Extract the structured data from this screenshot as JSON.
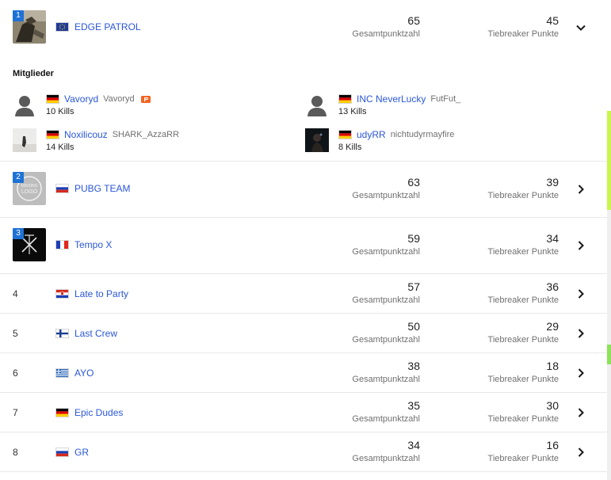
{
  "expanded_team": {
    "rank": "1",
    "name": "EDGE PATROL",
    "flag": "eu",
    "total": "65",
    "total_label": "Gesamtpunktzahl",
    "tiebreaker": "45",
    "tiebreaker_label": "Tiebreaker Punkte",
    "toggle_icon": "chevron-down-icon",
    "members_title": "Mitglieder",
    "members": [
      {
        "name": "Vavoryd",
        "handle": "Vavoryd",
        "kills": "10 Kills",
        "flag": "de",
        "extra_icon": "platform-p-icon",
        "avatar": "silhouette-avatar"
      },
      {
        "name": "INC NeverLucky",
        "handle": "FutFut_",
        "kills": "13 Kills",
        "flag": "de",
        "avatar": "silhouette-avatar"
      },
      {
        "name": "Noxilicouz",
        "handle": "SHARK_AzzaRR",
        "kills": "14 Kills",
        "flag": "de",
        "avatar": "photo-avatar-light"
      },
      {
        "name": "udyRR",
        "handle": "nichtudyrmayfire",
        "kills": "8 Kills",
        "flag": "de",
        "avatar": "photo-avatar-dark"
      }
    ]
  },
  "teams": [
    {
      "rank": "2",
      "name": "PUBG TEAM",
      "flag": "ru",
      "total": "63",
      "total_label": "Gesamtpunktzahl",
      "tiebreaker": "39",
      "tiebreaker_label": "Tiebreaker Punkte",
      "logo": "missing-logo"
    },
    {
      "rank": "3",
      "name": "Tempo X",
      "flag": "fr",
      "total": "59",
      "total_label": "Gesamtpunktzahl",
      "tiebreaker": "34",
      "tiebreaker_label": "Tiebreaker Punkte",
      "logo": "tempo-x-logo"
    },
    {
      "rank": "4",
      "name": "Late to Party",
      "flag": "hr",
      "total": "57",
      "total_label": "Gesamtpunktzahl",
      "tiebreaker": "36",
      "tiebreaker_label": "Tiebreaker Punkte"
    },
    {
      "rank": "5",
      "name": "Last Crew",
      "flag": "fi",
      "total": "50",
      "total_label": "Gesamtpunktzahl",
      "tiebreaker": "29",
      "tiebreaker_label": "Tiebreaker Punkte"
    },
    {
      "rank": "6",
      "name": "AYO",
      "flag": "gr",
      "total": "38",
      "total_label": "Gesamtpunktzahl",
      "tiebreaker": "18",
      "tiebreaker_label": "Tiebreaker Punkte"
    },
    {
      "rank": "7",
      "name": "Epic Dudes",
      "flag": "de",
      "total": "35",
      "total_label": "Gesamtpunktzahl",
      "tiebreaker": "30",
      "tiebreaker_label": "Tiebreaker Punkte"
    },
    {
      "rank": "8",
      "name": "GR",
      "flag": "ru",
      "total": "34",
      "total_label": "Gesamtpunktzahl",
      "tiebreaker": "16",
      "tiebreaker_label": "Tiebreaker Punkte"
    }
  ],
  "row_toggle_icon": "chevron-right-icon",
  "colors": {
    "link": "#2b57d9",
    "rank_badge": "#1e72d6",
    "divider": "#e8e8e8",
    "accent_scroll": "#c9f54e"
  }
}
